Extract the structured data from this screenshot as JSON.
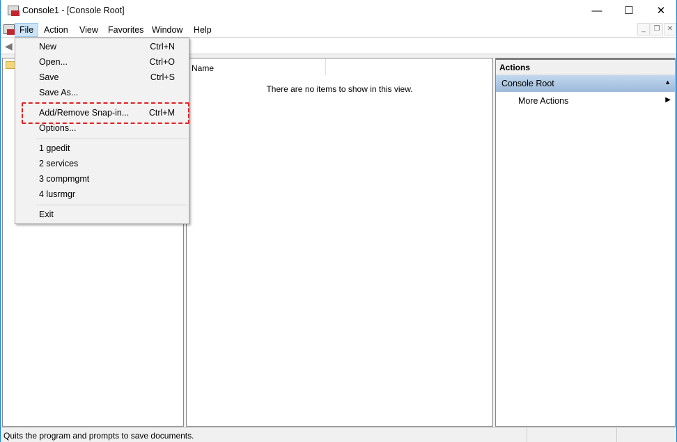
{
  "window": {
    "title": "Console1 - [Console Root]",
    "minimize": "—",
    "maximize": "☐",
    "close": "✕"
  },
  "menubar": [
    "File",
    "Action",
    "View",
    "Favorites",
    "Window",
    "Help"
  ],
  "mdi": {
    "minimize": "_",
    "restore": "❐",
    "close": "✕"
  },
  "file_menu": {
    "items": [
      {
        "label": "New",
        "shortcut": "Ctrl+N"
      },
      {
        "label": "Open...",
        "shortcut": "Ctrl+O"
      },
      {
        "label": "Save",
        "shortcut": "Ctrl+S"
      },
      {
        "label": "Save As...",
        "shortcut": ""
      },
      {
        "label": "Add/Remove Snap-in...",
        "shortcut": "Ctrl+M"
      },
      {
        "label": "Options...",
        "shortcut": ""
      }
    ],
    "recent": [
      "1 gpedit",
      "2 services",
      "3 compmgmt",
      "4 lusrmgr"
    ],
    "exit": "Exit"
  },
  "center": {
    "column": "Name",
    "empty_message": "There are no items to show in this view."
  },
  "actions": {
    "header": "Actions",
    "section": "Console Root",
    "more": "More Actions"
  },
  "status": "Quits the program and prompts to save documents."
}
